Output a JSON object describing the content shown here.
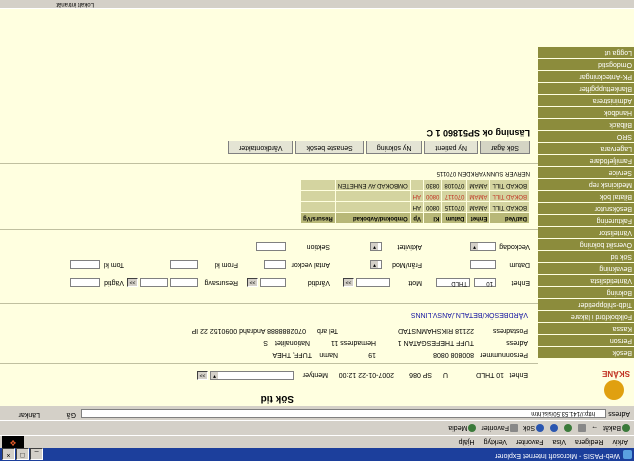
{
  "window": {
    "title": "Web-PASIS - Microsoft Internet Explorer",
    "min": "_",
    "max": "□",
    "close": "×"
  },
  "menu": [
    "Arkiv",
    "Redigera",
    "Visa",
    "Favoriter",
    "Verktyg",
    "Hjälp"
  ],
  "toolbar": {
    "back": "Bakåt",
    "forward": "→",
    "stop": "x",
    "refresh": "↻",
    "home": "⌂",
    "search": "Sök",
    "favorites": "Favoriter",
    "media": "Media"
  },
  "address": {
    "label": "Adress",
    "url": "http://141.53.50/sisi.htm",
    "go": "Gå",
    "links": "Länkar"
  },
  "sidebar": {
    "logo": "SKÅNE",
    "items": [
      "Besök",
      "Person",
      "Kassa",
      "Folkbokförd i läkare",
      "Tidb-shlöppetider",
      "Bokning",
      "Väntetidslista",
      "Bevakning",
      "Sök tid",
      "Översikt bokning",
      "Väntelistor",
      "Fakturering",
      "Besöksrutor",
      "Bilatal bök",
      "Medicinsk rep",
      "Service",
      "Familjefödare",
      "Lagervara",
      "SRO",
      "Bilbäck",
      "Handbok",
      "Administrera",
      "Blankettuppgifter",
      "PK-Anteckningar",
      "Omdogstid",
      "Logga ut"
    ]
  },
  "main": {
    "title": "Sök tid",
    "enhet_label": "Enhet",
    "enhet_value": "10 THLD",
    "u_value": "U",
    "sp_value": "SP 086",
    "date_value": "2007-01-22 12:00",
    "mention_label": "Mentyer",
    "person_label": "Personnummer",
    "person_value": "800808 0808",
    "person_extra": "19",
    "name_label": "Namn",
    "name_value": "TUFF, THEA",
    "address_label": "Adress",
    "address_value": "TUFF THEFESGATAN 1",
    "address_extra": "Hemadress 11",
    "nat_label": "Nationalitet",
    "nat_value": "S",
    "postadress_label": "Postadress",
    "postadress_value": "22118 RIKSHAMNSTAD",
    "tel_label": "Tel arb",
    "tel_value": "0702888888 Andrahd 0090152 22 IP",
    "link": "VÅRDBESÖK/BETALN./ANSV.LINNS"
  },
  "form": {
    "enhet_label": "Enhet",
    "enhet_v1": "10",
    "enhet_v2": "THLD",
    "mott_label": "Mott",
    "vardtid_label": "Vårdtid",
    "resursavg_label": "Resursavg",
    "vagtid_label": "Vägtid",
    "datum_label": "Datum",
    "fran_label": "Från/Mod",
    "antal_label": "Antal veckor",
    "fromkl_label": "From kl",
    "tomkl_label": "Tom kl",
    "veckodag_label": "Veckodag",
    "aktivitet_label": "Aktivitet",
    "sektion_label": "Sektion"
  },
  "results": {
    "headers": [
      "Dat/Ved",
      "Enhet",
      "Datum",
      "Kl",
      "Vp",
      "Omboknd/Avbokad",
      "Resurs/Vg"
    ],
    "rows": [
      [
        "BOKAD TILL",
        "AMAM",
        "070115",
        "0800",
        "AH",
        "",
        ""
      ],
      [
        "BOKAD TILL",
        "AMAM",
        "070117",
        "0800",
        "AH",
        "",
        ""
      ],
      [
        "BOKAD TILL",
        "AMAM",
        "070108",
        "0830",
        "",
        "OMBOKAD AV ENHETEN",
        ""
      ]
    ],
    "footer": "NERVER SUNNYARKDEN 070115"
  },
  "tabs": [
    "Sök ägar",
    "Ny patient",
    "Ny sökning",
    "Senaste besök",
    "Vårdkontakter"
  ],
  "page_heading": "Läsning ok SP51860 1 C",
  "status": {
    "zone": "Lokalt intranät"
  }
}
